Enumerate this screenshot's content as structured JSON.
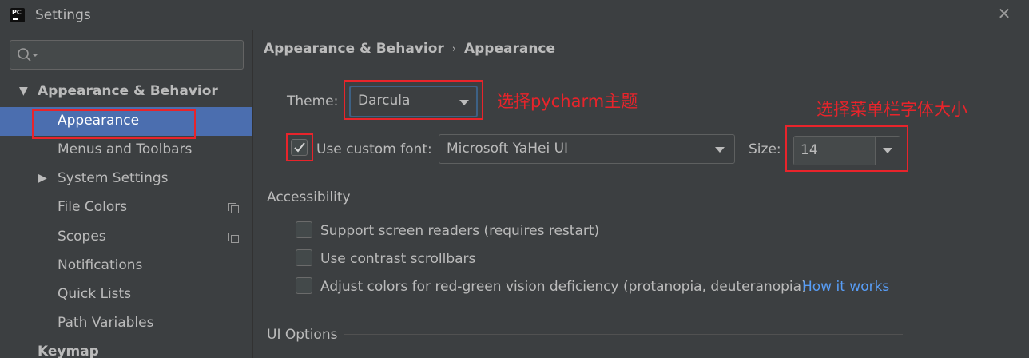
{
  "window": {
    "title": "Settings",
    "close_glyph": "✕",
    "app_icon": "pycharm-icon"
  },
  "sidebar": {
    "search_placeholder": "",
    "items": [
      {
        "label": "Appearance & Behavior",
        "expanded": true,
        "level": 0
      },
      {
        "label": "Appearance",
        "selected": true,
        "level": 1
      },
      {
        "label": "Menus and Toolbars",
        "level": 1
      },
      {
        "label": "System Settings",
        "collapsed": true,
        "level": 1
      },
      {
        "label": "File Colors",
        "level": 1,
        "icon": "copy-icon"
      },
      {
        "label": "Scopes",
        "level": 1,
        "icon": "copy-icon"
      },
      {
        "label": "Notifications",
        "level": 1
      },
      {
        "label": "Quick Lists",
        "level": 1
      },
      {
        "label": "Path Variables",
        "level": 1
      },
      {
        "label": "Keymap",
        "level": 0
      }
    ]
  },
  "breadcrumb": {
    "parent": "Appearance & Behavior",
    "separator": "›",
    "current": "Appearance"
  },
  "theme": {
    "label": "Theme:",
    "value": "Darcula"
  },
  "font": {
    "checkbox_checked": true,
    "label": "Use custom font:",
    "value": "Microsoft YaHei UI",
    "size_label": "Size:",
    "size_value": "14"
  },
  "accessibility": {
    "title": "Accessibility",
    "options": [
      {
        "label": "Support screen readers (requires restart)",
        "checked": false
      },
      {
        "label": "Use contrast scrollbars",
        "checked": false
      },
      {
        "label": "Adjust colors for red-green vision deficiency (protanopia, deuteranopia)",
        "checked": false
      }
    ],
    "link": "How it works"
  },
  "ui_options": {
    "title": "UI Options"
  },
  "annotations": {
    "theme_note": "选择pycharm主题",
    "font_note": "选择菜单栏字体大小",
    "color": "#e8242b"
  },
  "colors": {
    "background": "#3c3f41",
    "selection": "#4b6eaf",
    "link": "#589df6"
  }
}
